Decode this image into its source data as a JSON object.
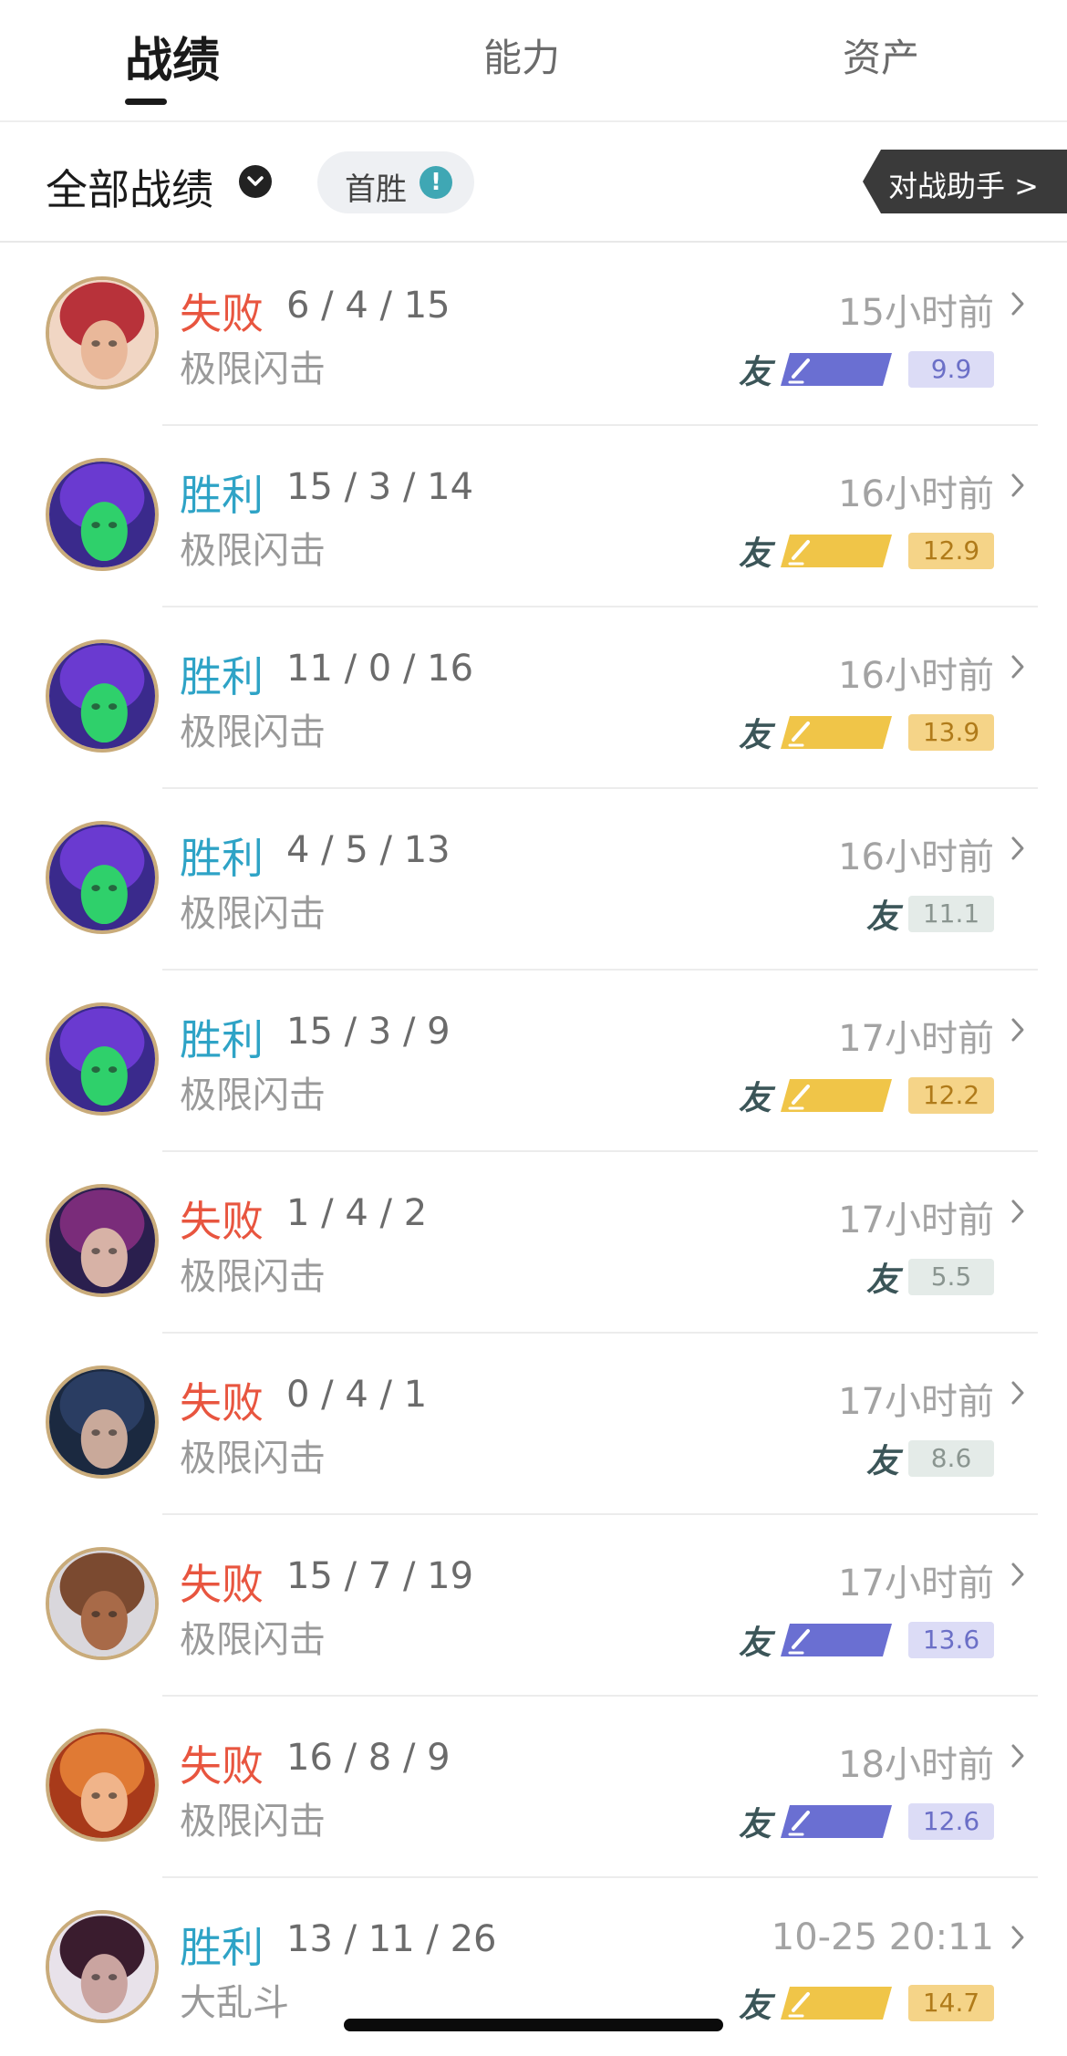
{
  "tabs": [
    {
      "label": "战绩",
      "active": true
    },
    {
      "label": "能力",
      "active": false
    },
    {
      "label": "资产",
      "active": false
    }
  ],
  "filter": {
    "label": "全部战绩",
    "pill_label": "首胜",
    "pill_icon": "!",
    "assistant_label": "对战助手 >"
  },
  "colors": {
    "lose": "#e8553f",
    "win": "#2ea3c6",
    "svp_badge": "#6a6fd2",
    "mvp_badge": "#f0c548",
    "svp_score_bg": "#dcdcf6",
    "svp_score_text": "#6b6fc7",
    "mvp_score_bg": "#f5d488",
    "mvp_score_text": "#b07b1a",
    "plain_score_bg": "#e4ebe8",
    "plain_score_text": "#8a9590"
  },
  "matches": [
    {
      "result": "失败",
      "outcome": "lose",
      "kda": "6 / 4 / 15",
      "mode": "极限闪击",
      "time": "15小时前",
      "friend": "友",
      "honor": "SVP",
      "score": "9.9",
      "avatar": "champion-portrait-red-hair"
    },
    {
      "result": "胜利",
      "outcome": "win",
      "kda": "15 / 3 / 14",
      "mode": "极限闪击",
      "time": "16小时前",
      "friend": "友",
      "honor": "MVP",
      "score": "12.9",
      "avatar": "champion-portrait-void-purple"
    },
    {
      "result": "胜利",
      "outcome": "win",
      "kda": "11 / 0 / 16",
      "mode": "极限闪击",
      "time": "16小时前",
      "friend": "友",
      "honor": "MVP",
      "score": "13.9",
      "avatar": "champion-portrait-void-purple"
    },
    {
      "result": "胜利",
      "outcome": "win",
      "kda": "4 / 5 / 13",
      "mode": "极限闪击",
      "time": "16小时前",
      "friend": "友",
      "honor": "",
      "score": "11.1",
      "avatar": "champion-portrait-void-purple"
    },
    {
      "result": "胜利",
      "outcome": "win",
      "kda": "15 / 3 / 9",
      "mode": "极限闪击",
      "time": "17小时前",
      "friend": "友",
      "honor": "MVP",
      "score": "12.2",
      "avatar": "champion-portrait-void-purple"
    },
    {
      "result": "失败",
      "outcome": "lose",
      "kda": "1 / 4 / 2",
      "mode": "极限闪击",
      "time": "17小时前",
      "friend": "友",
      "honor": "",
      "score": "5.5",
      "avatar": "champion-portrait-vayne"
    },
    {
      "result": "失败",
      "outcome": "lose",
      "kda": "0 / 4 / 1",
      "mode": "极限闪击",
      "time": "17小时前",
      "friend": "友",
      "honor": "",
      "score": "8.6",
      "avatar": "champion-portrait-dark-hair"
    },
    {
      "result": "失败",
      "outcome": "lose",
      "kda": "15 / 7 / 19",
      "mode": "极限闪击",
      "time": "17小时前",
      "friend": "友",
      "honor": "SVP",
      "score": "13.6",
      "avatar": "champion-portrait-lucian"
    },
    {
      "result": "失败",
      "outcome": "lose",
      "kda": "16 / 8 / 9",
      "mode": "极限闪击",
      "time": "18小时前",
      "friend": "友",
      "honor": "SVP",
      "score": "12.6",
      "avatar": "champion-portrait-orange-hair"
    },
    {
      "result": "胜利",
      "outcome": "win",
      "kda": "13 / 11 / 26",
      "mode": "大乱斗",
      "time": "10-25 20:11",
      "friend": "友",
      "honor": "MVP",
      "score": "14.7",
      "avatar": "champion-portrait-crowned"
    }
  ]
}
